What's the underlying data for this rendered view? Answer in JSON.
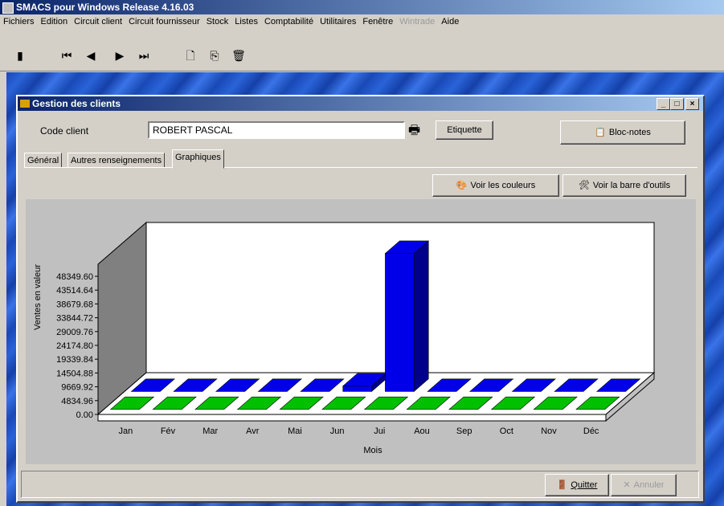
{
  "app": {
    "title": "SMACS pour Windows Release 4.16.03",
    "menu": [
      "Fichiers",
      "Edition",
      "Circuit client",
      "Circuit fournisseur",
      "Stock",
      "Listes",
      "Comptabilité",
      "Utilitaires",
      "Fenêtre",
      "Wintrade",
      "Aide"
    ]
  },
  "window": {
    "title": "Gestion des clients",
    "code_label": "Code client",
    "code_value": "ROBERT PASCAL",
    "etiquette_label": "Etiquette",
    "blocnotes_label": "Bloc-notes",
    "tabs": [
      "Général",
      "Autres renseignements",
      "Graphiques"
    ],
    "active_tab": "Graphiques",
    "voir_couleurs_label": "Voir les couleurs",
    "voir_barre_label": "Voir la barre d'outils",
    "quitter_label": "Quitter",
    "annuler_label": "Annuler"
  },
  "chart_data": {
    "type": "bar",
    "xlabel": "Mois",
    "ylabel": "Ventes en valeur",
    "categories": [
      "Jan",
      "Fév",
      "Mar",
      "Avr",
      "Mai",
      "Jun",
      "Jui",
      "Aou",
      "Sep",
      "Oct",
      "Nov",
      "Déc"
    ],
    "y_ticks": [
      "0.00",
      "4834.96",
      "9669.92",
      "14504.88",
      "19339.84",
      "24174.80",
      "29009.76",
      "33844.72",
      "38679.68",
      "43514.64",
      "48349.60"
    ],
    "ylim": [
      0,
      48349.6
    ],
    "series": [
      {
        "color": "#0000e8",
        "values": [
          0,
          0,
          0,
          0,
          0,
          1900,
          48300,
          0,
          0,
          0,
          0,
          0
        ]
      },
      {
        "color": "#00c000",
        "values": [
          0,
          0,
          0,
          0,
          0,
          0,
          0,
          0,
          0,
          0,
          0,
          0
        ]
      }
    ]
  }
}
